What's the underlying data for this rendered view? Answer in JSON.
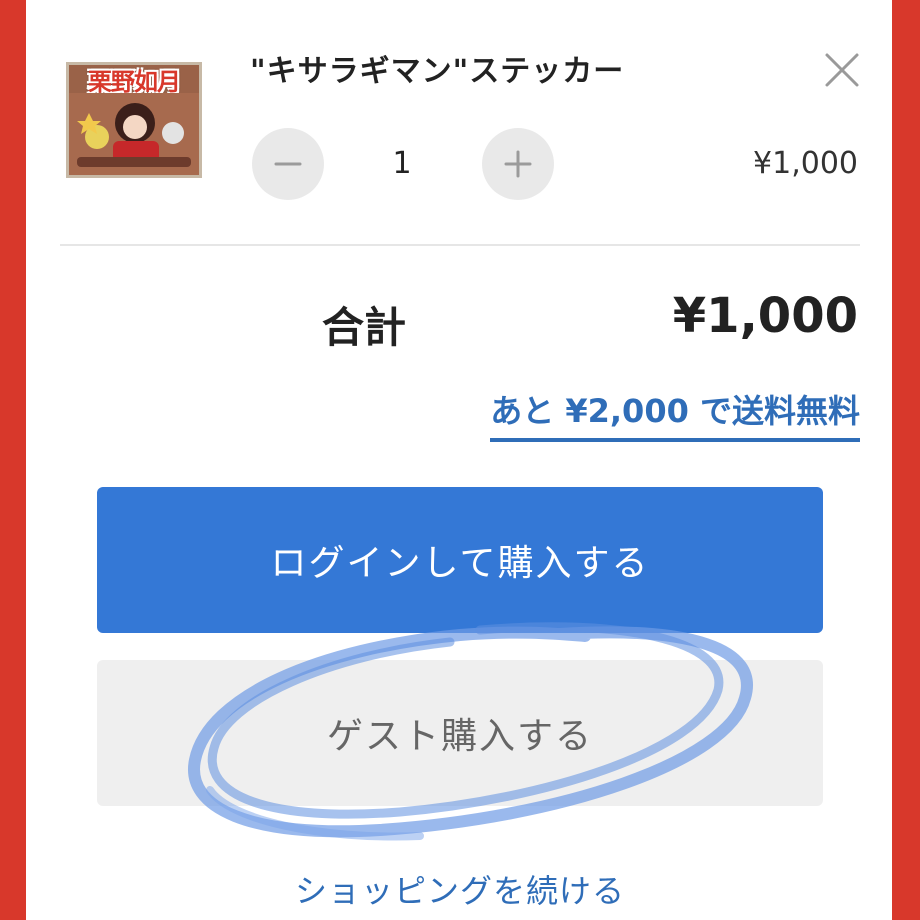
{
  "cart": {
    "item": {
      "title": "\"キサラギマン\"ステッカー",
      "thumbnail_text": "栗野如月",
      "quantity": "1",
      "price": "¥1,000"
    },
    "total_label": "合計",
    "total_value": "¥1,000",
    "free_shipping_note": "あと ¥2,000 で送料無料"
  },
  "actions": {
    "login_purchase": "ログインして購入する",
    "guest_purchase": "ゲスト購入する",
    "continue_shopping": "ショッピングを続ける"
  },
  "icons": {
    "close": "close-icon",
    "decrement": "minus-icon",
    "increment": "plus-icon"
  },
  "colors": {
    "background_red": "#d8382b",
    "primary_blue": "#3478d6",
    "link_blue": "#2f6db8",
    "guest_button": "#efefef",
    "highlight_scribble": "#6f9be6"
  }
}
